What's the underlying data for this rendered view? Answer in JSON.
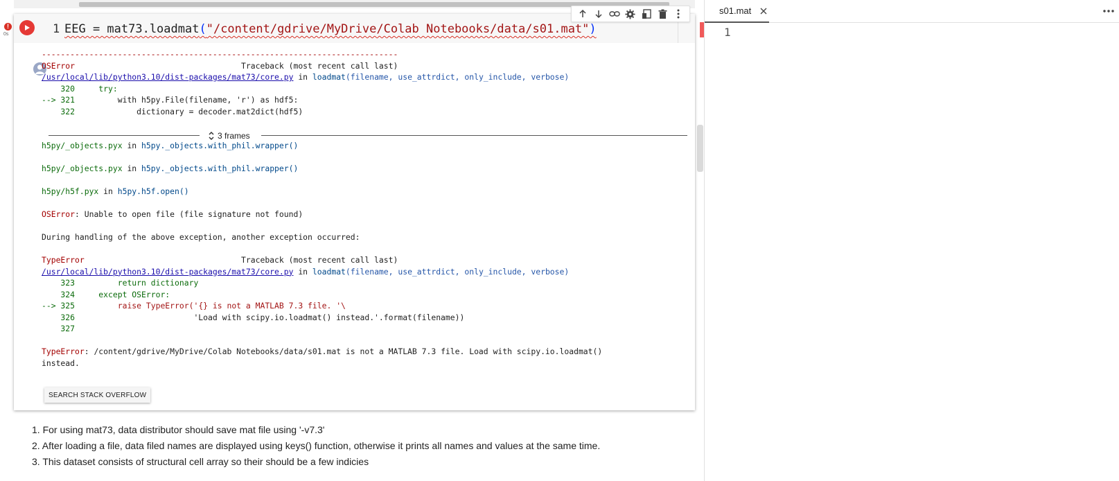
{
  "cell": {
    "line_number": "1",
    "code": {
      "prefix": "EEG = mat73.loadmat",
      "open_paren": "(",
      "string": "\"/content/gdrive/MyDrive/Colab Notebooks/data/s01.mat\"",
      "close_paren": ")"
    },
    "status": {
      "error_badge": "!",
      "exec_time": "0s"
    },
    "toolbar_icons": [
      "arrow-up-icon",
      "arrow-down-icon",
      "link-icon",
      "gear-icon",
      "mirror-cell-icon",
      "trash-icon",
      "more-vert-icon"
    ]
  },
  "output": {
    "dashes": "---------------------------------------------------------------------------",
    "block1": {
      "error_name": "OSError",
      "traceback_header": "                                   Traceback (most recent call last)",
      "path": "/usr/local/lib/python3.10/dist-packages/mat73/core.py",
      "in": " in ",
      "func": "loadmat",
      "args": "(filename, use_attrdict, only_include, verbose)",
      "lines": [
        {
          "prefix": "    320     ",
          "code": "try:"
        },
        {
          "prefix": "--> 321         ",
          "code": "with h5py.File(filename, 'r') as hdf5:"
        },
        {
          "prefix": "    322             ",
          "code": "dictionary = decoder.mat2dict(hdf5)"
        }
      ]
    },
    "frames_label": "3 frames",
    "frames": [
      {
        "module": "h5py/_objects.pyx",
        "in": " in ",
        "func": "h5py._objects.with_phil.wrapper()"
      },
      {
        "module": "h5py/_objects.pyx",
        "in": " in ",
        "func": "h5py._objects.with_phil.wrapper()"
      },
      {
        "module": "h5py/h5f.pyx",
        "in": " in ",
        "func": "h5py.h5f.open()"
      }
    ],
    "oserror_name": "OSError",
    "oserror_msg": ": Unable to open file (file signature not found)",
    "during": "During handling of the above exception, another exception occurred:",
    "block2": {
      "error_name": "TypeError",
      "traceback_header": "                                 Traceback (most recent call last)",
      "path": "/usr/local/lib/python3.10/dist-packages/mat73/core.py",
      "in": " in ",
      "func": "loadmat",
      "args": "(filename, use_attrdict, only_include, verbose)",
      "lines": [
        {
          "prefix": "    323         ",
          "code": "return dictionary",
          "cls": ""
        },
        {
          "prefix": "    324     ",
          "code": "except OSError:",
          "cls": ""
        },
        {
          "prefix": "--> 325         ",
          "code": "raise TypeError('{} is not a MATLAB 7.3 file. '\\",
          "cls": "estr"
        },
        {
          "prefix": "    326                         ",
          "code": "'Load with scipy.io.loadmat() instead.'.format(filename))",
          "cls": ""
        },
        {
          "prefix": "    327",
          "code": "",
          "cls": ""
        }
      ]
    },
    "final_name": "TypeError",
    "final_msg": ": /content/gdrive/MyDrive/Colab Notebooks/data/s01.mat is not a MATLAB 7.3 file. Load with scipy.io.loadmat()",
    "final_msg2": "instead.",
    "so_button": "SEARCH STACK OVERFLOW"
  },
  "notes": [
    "1. For using mat73, data distributor should save mat file using '-v7.3'",
    "2. After loading a file, data filed names are displayed using keys() function, otherwise it prints all names and values at the same time.",
    "3. This dataset consists of structural cell array so their should be a few indicies"
  ],
  "editor": {
    "tab_label": "s01.mat",
    "line_number": "1"
  },
  "colors": {
    "run_button": "#e53935",
    "error_text": "#a30000",
    "link": "#1a0dab"
  }
}
